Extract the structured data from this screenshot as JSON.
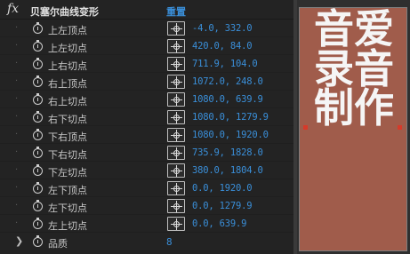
{
  "effect": {
    "fx_label": "fx",
    "name": "贝塞尔曲线变形",
    "reset_label": "重置"
  },
  "params": [
    {
      "label": "上左顶点",
      "value": "-4.0, 332.0"
    },
    {
      "label": "上左切点",
      "value": "420.0, 84.0"
    },
    {
      "label": "上右切点",
      "value": "711.9, 104.0"
    },
    {
      "label": "右上顶点",
      "value": "1072.0, 248.0"
    },
    {
      "label": "右上切点",
      "value": "1080.0, 639.9"
    },
    {
      "label": "右下切点",
      "value": "1080.0, 1279.9"
    },
    {
      "label": "下右顶点",
      "value": "1080.0, 1920.0"
    },
    {
      "label": "下右切点",
      "value": "735.9, 1828.0"
    },
    {
      "label": "下左切点",
      "value": "380.0, 1804.0"
    },
    {
      "label": "左下顶点",
      "value": "0.0, 1920.0"
    },
    {
      "label": "左下切点",
      "value": "0.0, 1279.9"
    },
    {
      "label": "左上切点",
      "value": "0.0, 639.9"
    }
  ],
  "quality": {
    "label": "品质",
    "value": "8",
    "expand_icon": "chevron-right-icon"
  },
  "preview": {
    "text": "音爱录音制作",
    "background_color": "#a05c4b",
    "text_color": "#f5f5f5",
    "handle_color": "#d63a2a"
  },
  "colors": {
    "panel_bg": "#232323",
    "value_blue": "#3a8fd9",
    "label_gray": "#c9c9c9"
  }
}
